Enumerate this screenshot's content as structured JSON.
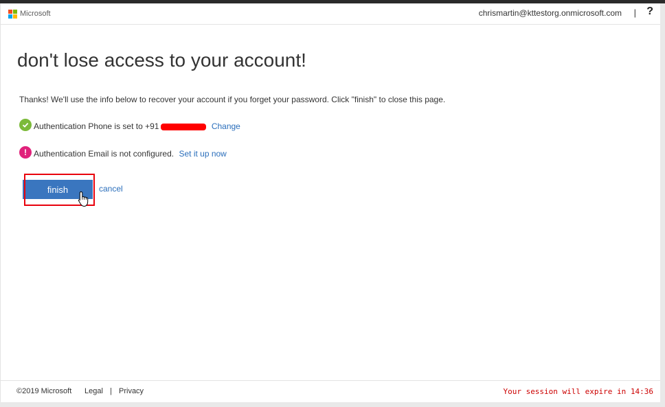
{
  "header": {
    "brand": "Microsoft",
    "user_email": "chrismartin@kttestorg.onmicrosoft.com",
    "separator": "|",
    "help_label": "?"
  },
  "main": {
    "title": "don't lose access to your account!",
    "intro": "Thanks! We'll use the info below to recover your account if you forget your password. Click \"finish\" to close this page.",
    "phone": {
      "status": "ok",
      "text": "Authentication Phone is set to +91",
      "link_label": "Change"
    },
    "email": {
      "status": "warning",
      "text": "Authentication Email is not configured.",
      "link_label": "Set it up now"
    },
    "finish_label": "finish",
    "cancel_label": "cancel"
  },
  "footer": {
    "copyright": "©2019 Microsoft",
    "legal": "Legal",
    "separator": "|",
    "privacy": "Privacy",
    "session_text": "Your session will expire in 14:36"
  },
  "colors": {
    "accent": "#3a76bf",
    "link": "#2a6ebb",
    "ok": "#7cba3a",
    "warning": "#e0227b",
    "highlight": "#e8000b",
    "session_warning": "#cc0000"
  },
  "icons": {
    "logo": "microsoft-logo-icon",
    "ok": "checkmark-circle-icon",
    "warning": "exclamation-circle-icon",
    "cursor": "hand-pointer-cursor-icon"
  }
}
